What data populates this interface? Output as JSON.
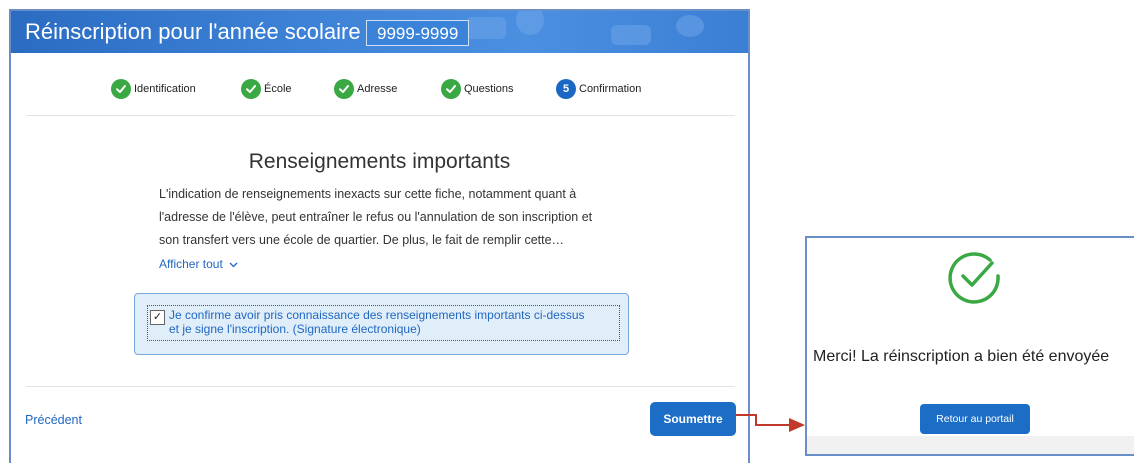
{
  "header": {
    "title": "Réinscription pour l'année scolaire",
    "year": "9999-9999"
  },
  "stepper": {
    "steps": [
      {
        "label": "Identification",
        "status": "done"
      },
      {
        "label": "École",
        "status": "done"
      },
      {
        "label": "Adresse",
        "status": "done"
      },
      {
        "label": "Questions",
        "status": "done"
      },
      {
        "label": "Confirmation",
        "status": "current",
        "number": "5"
      }
    ]
  },
  "content": {
    "title": "Renseignements importants",
    "paragraph_lines": [
      "L'indication de renseignements inexacts sur cette fiche, notamment quant à",
      "l'adresse de l'élève, peut entraîner le refus ou l'annulation de son inscription et",
      "son transfert vers une école de quartier. De plus, le fait de remplir cette…"
    ],
    "show_all": "Afficher tout",
    "confirm_lines": [
      "Je confirme avoir pris connaissance des renseignements importants ci-dessus",
      "et je signe l'inscription. (Signature électronique)"
    ],
    "confirm_checked": true,
    "check_mark": "✓"
  },
  "footer": {
    "previous": "Précédent",
    "submit": "Soumettre"
  },
  "success": {
    "message": "Merci! La réinscription a bien été envoyée",
    "portal_button": "Retour au portail"
  },
  "colors": {
    "header_blue": "#3d82d6",
    "step_done": "#3aa843",
    "step_current": "#1b67c4",
    "link_blue": "#2167c1",
    "button_blue": "#1b6dc6",
    "confirm_bg": "#e0eef9",
    "arrow_red": "#c0392b",
    "window_border": "#6a8ec8"
  }
}
